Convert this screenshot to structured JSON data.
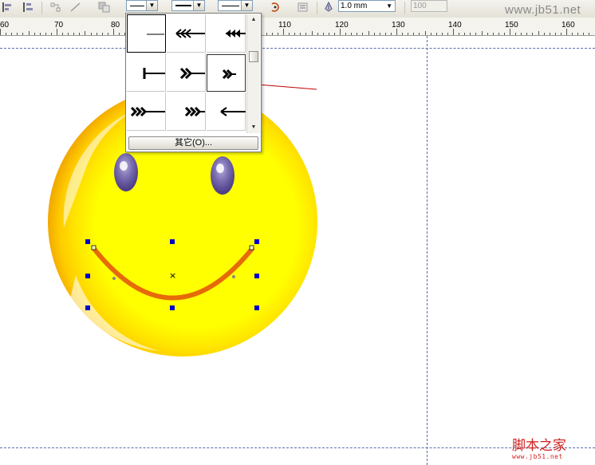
{
  "toolbar": {
    "outline_width": "1.0 mm",
    "dropdown_arrow": "▼",
    "value_field": "100",
    "watermark": "www.jb51.net",
    "icons": [
      "align-icon",
      "distribute-icon",
      "connect-icon",
      "line-tool-icon",
      "arrange-icon",
      "start-arrow-dropdown",
      "line-style-dropdown",
      "end-arrow-dropdown",
      "convert-icon",
      "wrap-icon",
      "outline-pen-icon"
    ]
  },
  "ruler": {
    "labels": [
      "60",
      "70",
      "80",
      "110",
      "120",
      "130",
      "140",
      "150",
      "160"
    ]
  },
  "arrow_popup": {
    "other_button_label": "其它(O)...",
    "scroll_up": "▲",
    "scroll_down": "▼",
    "cells": [
      "none",
      "triple-chevron-left",
      "triple-arrow-left",
      "tail-bar",
      "double-chevron-right",
      "double-chevron-right-small",
      "triple-chevron-right",
      "triple-chevron-right-2",
      "arrow-left"
    ]
  },
  "canvas": {
    "colors": {
      "face": "#ffea00",
      "face_edge": "#f2a900",
      "eyes": "#6a5ba0",
      "mouth": "#e66a0a",
      "handle": "#0000c8",
      "annotation_arrow": "#c00000",
      "guide": "#5a6da8"
    }
  },
  "footer_watermark": {
    "brand": "脚本之家",
    "url": "www.jb51.net"
  }
}
